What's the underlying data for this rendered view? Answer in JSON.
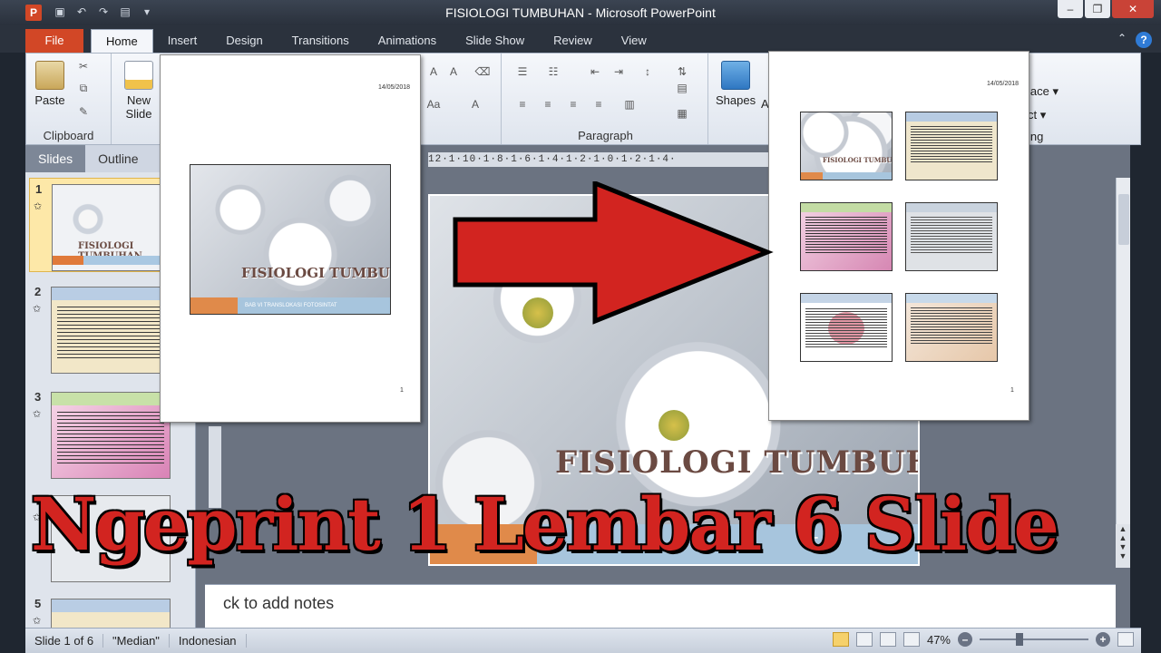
{
  "window": {
    "title": "FISIOLOGI TUMBUHAN - Microsoft PowerPoint",
    "app_icon_letter": "P"
  },
  "ribbon_tabs": {
    "file": "File",
    "tabs": [
      "Home",
      "Insert",
      "Design",
      "Transitions",
      "Animations",
      "Slide Show",
      "Review",
      "View"
    ]
  },
  "ribbon": {
    "clipboard": {
      "paste": "Paste",
      "group": "Clipboard"
    },
    "slides": {
      "new_slide_line1": "New",
      "new_slide_line2": "Slide"
    },
    "paragraph": {
      "group": "Paragraph"
    },
    "drawing": {
      "shapes": "Shapes",
      "shapes_suffix": "A",
      "replace": "lace",
      "select": "ct",
      "editing": "ing"
    }
  },
  "left_panel": {
    "tabs": [
      "Slides",
      "Outline"
    ],
    "thumbs": [
      {
        "num": "1",
        "title": "FISIOLOGI TUMBUHAN",
        "subtitle": "BAB VI TRANSLOKASI FOTOSINTAT"
      },
      {
        "num": "2"
      },
      {
        "num": "3"
      },
      {
        "num": "4"
      },
      {
        "num": "5"
      }
    ]
  },
  "ruler": {
    "text": "12·1·10·1·8·1·6·1·4·1·2·1·0·1·2·1·4·"
  },
  "main_slide": {
    "title": "FISIOLOGI TUMBUHAN",
    "subtitle_fragment": "T"
  },
  "notes": {
    "placeholder": "ck to add notes"
  },
  "print_page_left": {
    "date": "14/05/2018",
    "page_num": "1",
    "slide_title": "FISIOLOGI TUMBUHAN",
    "slide_subtitle": "BAB VI TRANSLOKASI FOTOSINTAT"
  },
  "print_page_right": {
    "date": "14/05/2018",
    "page_num": "1",
    "slide1_title": "FISIOLOGI TUMBUHAN"
  },
  "caption": "Ngeprint 1 Lembar 6 Slide",
  "status": {
    "slide": "Slide 1 of 6",
    "theme": "\"Median\"",
    "language": "Indonesian",
    "zoom": "47%"
  },
  "colors": {
    "file_tab": "#d24726",
    "arrow": "#d22420",
    "caption": "#d22420",
    "slide_title": "#6b4a42"
  }
}
